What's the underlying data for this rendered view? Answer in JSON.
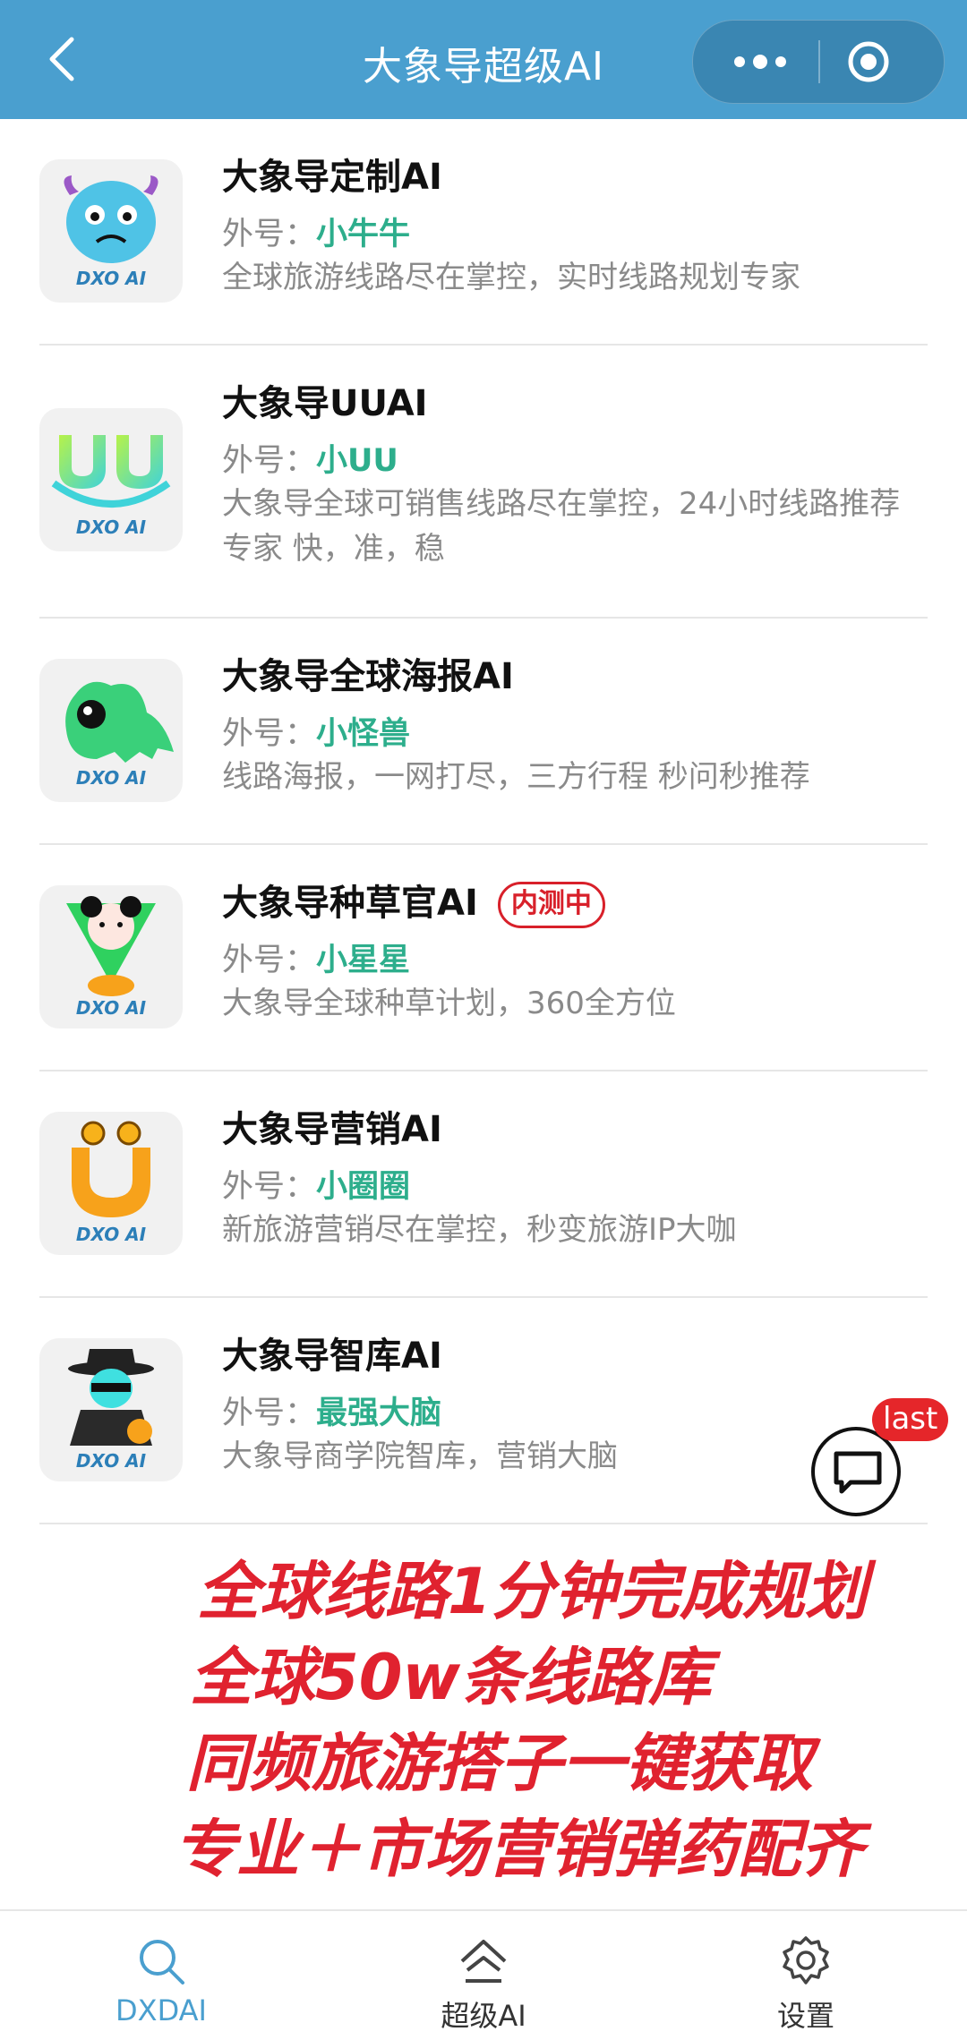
{
  "header": {
    "title": "大象导超级AI",
    "accent": "#4a9fcf"
  },
  "list": {
    "alias_prefix": "外号：",
    "items": [
      {
        "name": "大象导定制AI",
        "alias": "小牛牛",
        "desc": "全球旅游线路尽在掌控，实时线路规划专家",
        "badge": "",
        "avatar_logo": "DXO AI",
        "avatar_icon": "blue-monster-icon"
      },
      {
        "name": "大象导UUAI",
        "alias": "小UU",
        "desc": "大象导全球可销售线路尽在掌控，24小时线路推荐专家 快，准，稳",
        "badge": "",
        "avatar_logo": "DXO AI",
        "avatar_icon": "uu-logo-icon"
      },
      {
        "name": "大象导全球海报AI",
        "alias": "小怪兽",
        "desc": "线路海报，一网打尽，三方行程 秒问秒推荐",
        "badge": "",
        "avatar_logo": "DXO AI",
        "avatar_icon": "green-dinosaur-icon"
      },
      {
        "name": "大象导种草官AI",
        "alias": "小星星",
        "desc": "大象导全球种草计划，360全方位",
        "badge": "内测中",
        "avatar_logo": "DXO AI",
        "avatar_icon": "panda-pin-icon"
      },
      {
        "name": "大象导营销AI",
        "alias": "小圈圈",
        "desc": "新旅游营销尽在掌控，秒变旅游IP大咖",
        "badge": "",
        "avatar_logo": "DXO AI",
        "avatar_icon": "orange-u-icon"
      },
      {
        "name": "大象导智库AI",
        "alias": "最强大脑",
        "desc": "大象导商学院智库，营销大脑",
        "badge": "",
        "avatar_logo": "DXO AI",
        "avatar_icon": "detective-icon"
      }
    ]
  },
  "chat_bubble": {
    "badge": "last"
  },
  "promo": {
    "lines": [
      "全球线路1分钟完成规划",
      "全球50w条线路库",
      "同频旅游搭子一键获取",
      "专业＋市场营销弹药配齐"
    ],
    "color": "#e0222f"
  },
  "tabbar": {
    "tabs": [
      {
        "label": "DXDAI",
        "icon": "search-icon",
        "active": true
      },
      {
        "label": "超级AI",
        "icon": "home-icon",
        "active": false
      },
      {
        "label": "设置",
        "icon": "gear-icon",
        "active": false
      }
    ]
  }
}
